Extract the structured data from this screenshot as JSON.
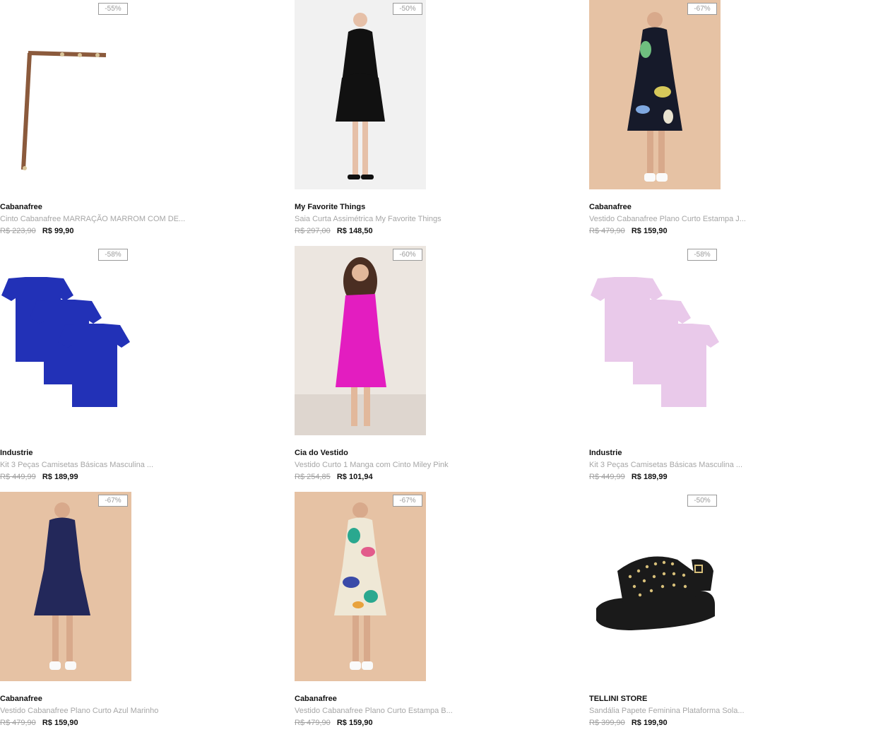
{
  "products": [
    {
      "discount": "-55%",
      "brand": "Cabanafree",
      "name": "Cinto Cabanafree MARRAÇÃO MARROM COM DE...",
      "old_price": "R$ 223,90",
      "price": "R$ 99,90",
      "image": "belt-image"
    },
    {
      "discount": "-50%",
      "brand": "My Favorite Things",
      "name": "Saia Curta Assimétrica My Favorite Things",
      "old_price": "R$ 297,00",
      "price": "R$ 148,50",
      "image": "black-outfit-image"
    },
    {
      "discount": "-67%",
      "brand": "Cabanafree",
      "name": "Vestido Cabanafree Plano Curto Estampa J...",
      "old_price": "R$ 479,90",
      "price": "R$ 159,90",
      "image": "print-dress-image"
    },
    {
      "discount": "-58%",
      "brand": "Industrie",
      "name": "Kit 3 Peças Camisetas Básicas Masculina ...",
      "old_price": "R$ 449,99",
      "price": "R$ 189,99",
      "image": "blue-tshirts-image"
    },
    {
      "discount": "-60%",
      "brand": "Cia do Vestido",
      "name": "Vestido Curto 1 Manga com Cinto Miley Pink",
      "old_price": "R$ 254,85",
      "price": "R$ 101,94",
      "image": "pink-dress-image"
    },
    {
      "discount": "-58%",
      "brand": "Industrie",
      "name": "Kit 3 Peças Camisetas Básicas Masculina ...",
      "old_price": "R$ 449,99",
      "price": "R$ 189,99",
      "image": "pink-tshirts-image"
    },
    {
      "discount": "-67%",
      "brand": "Cabanafree",
      "name": "Vestido Cabanafree Plano Curto Azul Marinho",
      "old_price": "R$ 479,90",
      "price": "R$ 159,90",
      "image": "navy-dress-image"
    },
    {
      "discount": "-67%",
      "brand": "Cabanafree",
      "name": "Vestido Cabanafree Plano Curto Estampa B...",
      "old_price": "R$ 479,90",
      "price": "R$ 159,90",
      "image": "abstract-dress-image"
    },
    {
      "discount": "-50%",
      "brand": "TELLINI STORE",
      "name": "Sandália Papete Feminina Plataforma Sola...",
      "old_price": "R$ 399,90",
      "price": "R$ 199,90",
      "image": "studded-sandal-image"
    }
  ],
  "colors": {
    "badge_border": "#9a9a9a",
    "muted_text": "#a6a6a6",
    "price_text": "#111111",
    "beige_bg": "#e6c2a4"
  }
}
